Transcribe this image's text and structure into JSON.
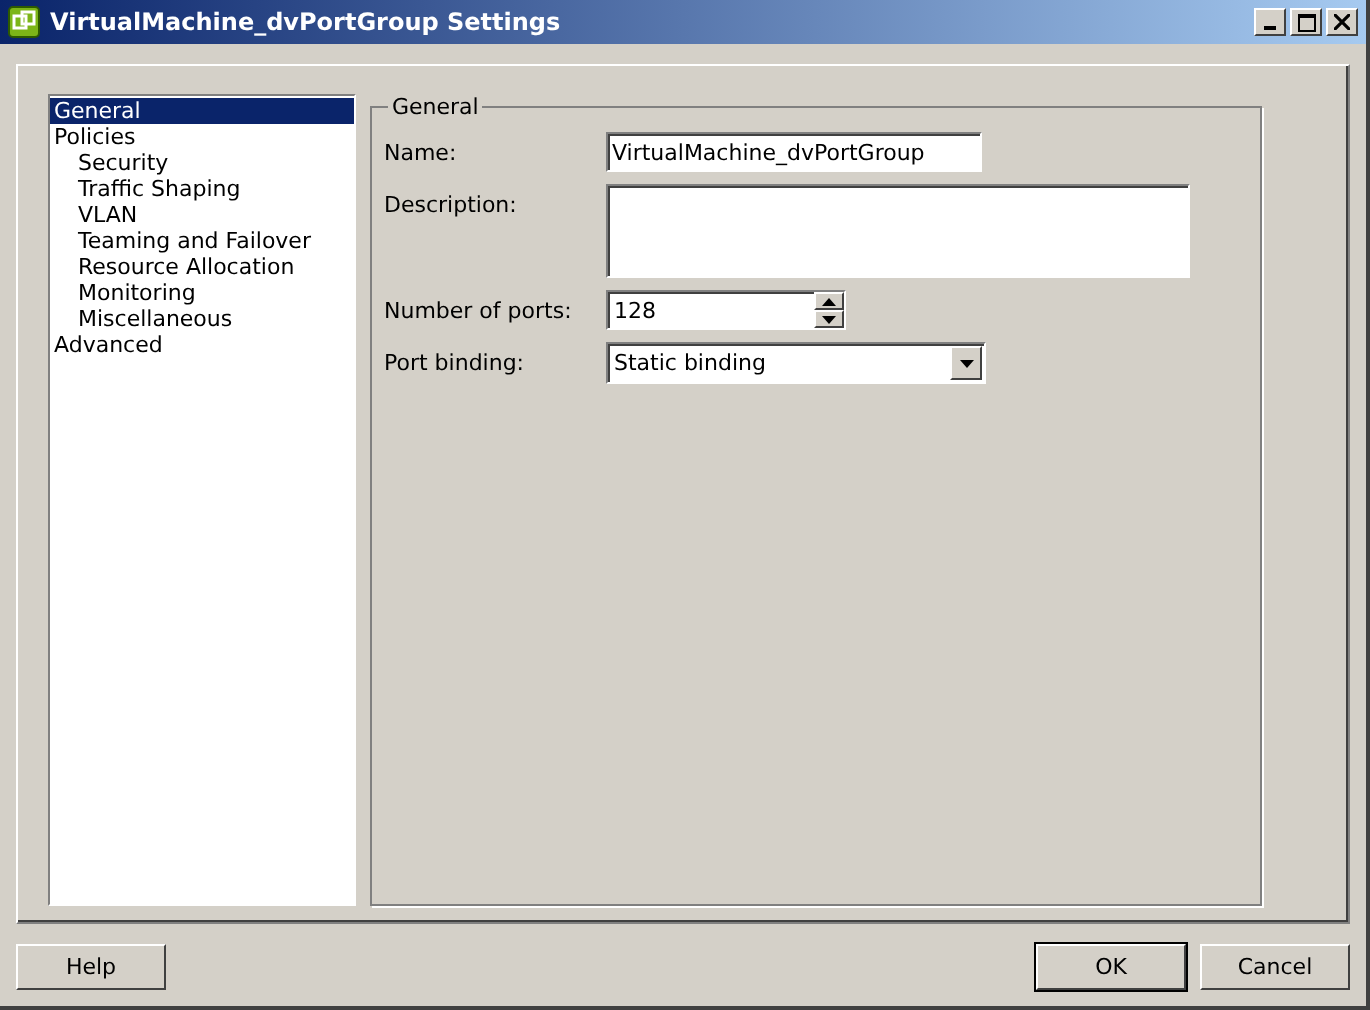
{
  "window": {
    "title": "VirtualMachine_dvPortGroup Settings"
  },
  "sidebar": {
    "items": [
      {
        "label": "General",
        "selected": true
      },
      {
        "label": "Policies",
        "selected": false,
        "children": [
          {
            "label": "Security",
            "selected": false
          },
          {
            "label": "Traffic Shaping",
            "selected": false
          },
          {
            "label": "VLAN",
            "selected": false
          },
          {
            "label": "Teaming and Failover",
            "selected": false
          },
          {
            "label": "Resource Allocation",
            "selected": false
          },
          {
            "label": "Monitoring",
            "selected": false
          },
          {
            "label": "Miscellaneous",
            "selected": false
          }
        ]
      },
      {
        "label": "Advanced",
        "selected": false
      }
    ]
  },
  "group": {
    "title": "General",
    "fields": [
      {
        "kind": "text",
        "label": "Name:",
        "value": "VirtualMachine_dvPortGroup"
      },
      {
        "kind": "textarea",
        "label": "Description:"
      },
      {
        "kind": "spinner",
        "label": "Number of ports:",
        "value": "128"
      },
      {
        "kind": "dropdown",
        "label": "Port binding:",
        "value": "Static binding"
      }
    ]
  },
  "buttons": [
    {
      "label": "Help",
      "default": false
    },
    {
      "label": "OK",
      "default": true
    },
    {
      "label": "Cancel",
      "default": false
    }
  ]
}
